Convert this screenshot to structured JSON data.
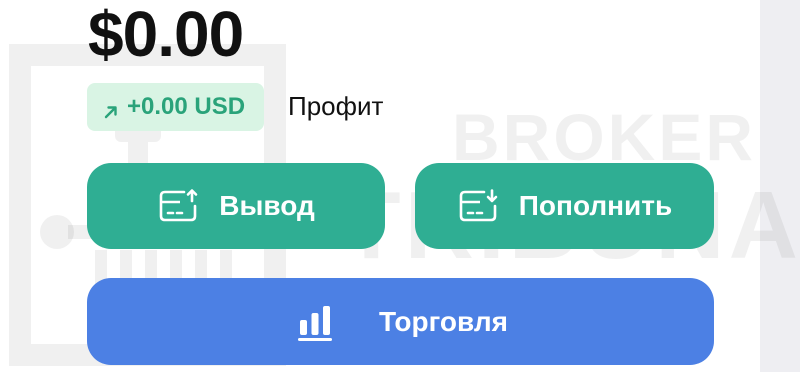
{
  "balance": {
    "amount": "$0.00"
  },
  "profit": {
    "value": "+0.00 USD",
    "label": "Профит",
    "icon": "arrow-up-right-icon"
  },
  "actions": {
    "withdraw_label": "Вывод",
    "withdraw_icon": "card-upload-icon",
    "deposit_label": "Пополнить",
    "deposit_icon": "card-download-icon",
    "trade_label": "Торговля",
    "trade_icon": "bar-chart-icon"
  },
  "watermark": {
    "line1": "BROKER",
    "line2": "TRIBUNAL"
  },
  "colors": {
    "primary_green": "#2fae93",
    "profit_green": "#2aa37a",
    "profit_badge_bg": "#d9f4e4",
    "trade_blue": "#4c80e4",
    "text_dark": "#111111"
  }
}
